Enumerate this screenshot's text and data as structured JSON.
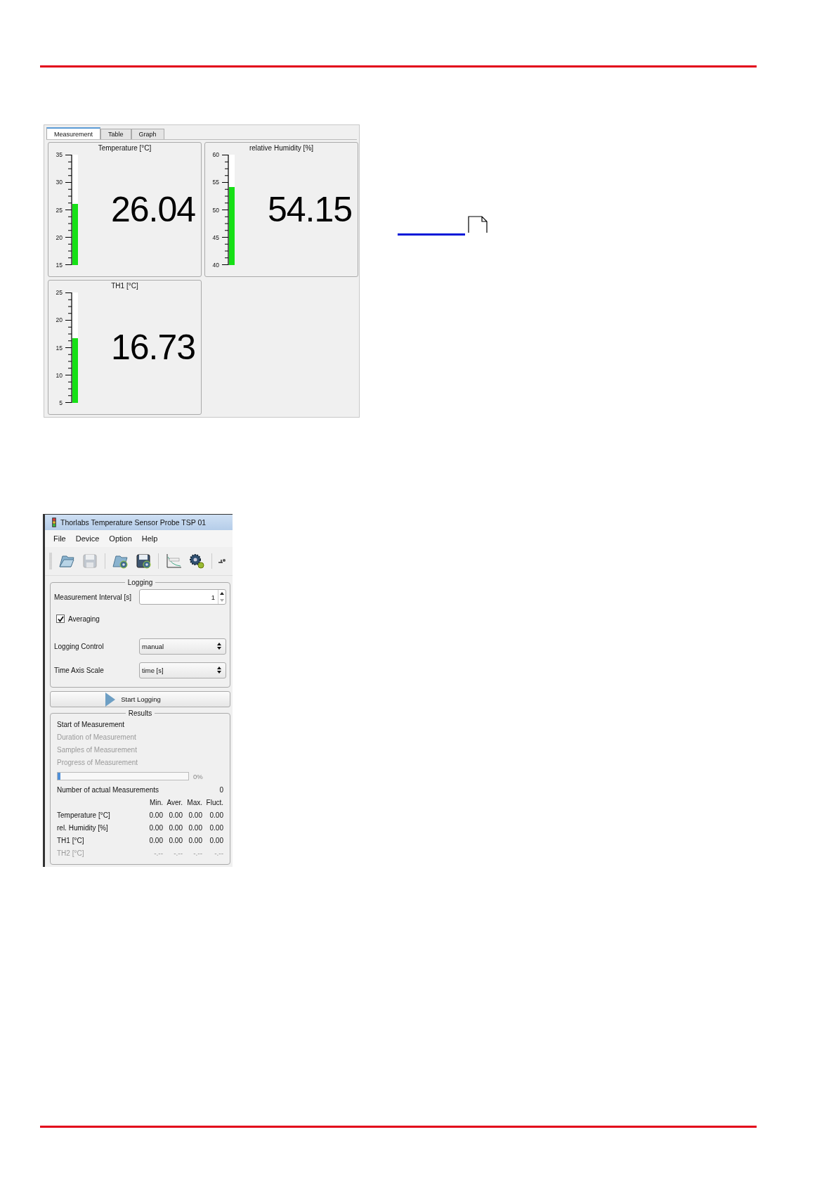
{
  "measurement_window": {
    "tabs": [
      {
        "label": "Measurement",
        "selected": true
      },
      {
        "label": "Table",
        "selected": false
      },
      {
        "label": "Graph",
        "selected": false
      }
    ],
    "meters": [
      {
        "title": "Temperature [°C]",
        "ticks": [
          "35",
          "30",
          "25",
          "20",
          "15"
        ],
        "level": 0.552,
        "value": "26.04"
      },
      {
        "title": "relative Humidity [%]",
        "ticks": [
          "60",
          "55",
          "50",
          "45",
          "40"
        ],
        "level": 0.7075,
        "value": "54.15"
      },
      {
        "title": "TH1 [°C]",
        "ticks": [
          "25",
          "20",
          "15",
          "10",
          "5"
        ],
        "level": 0.5865,
        "value": "16.73"
      }
    ]
  },
  "app_window": {
    "title": "Thorlabs Temperature Sensor Probe TSP 01",
    "menu": [
      "File",
      "Device",
      "Option",
      "Help"
    ],
    "toolbar": [
      {
        "kind": "open",
        "disabled": false
      },
      {
        "kind": "save",
        "disabled": true
      },
      {
        "kind": "separator"
      },
      {
        "kind": "open-config",
        "disabled": false
      },
      {
        "kind": "save-config",
        "disabled": false
      },
      {
        "kind": "separator"
      },
      {
        "kind": "clear",
        "disabled": false
      },
      {
        "kind": "settings",
        "disabled": false
      },
      {
        "kind": "separator"
      },
      {
        "kind": "connect",
        "disabled": false
      }
    ],
    "logging": {
      "title": "Logging",
      "interval_label": "Measurement Interval [s]",
      "interval_value": "1",
      "averaging": {
        "label": "Averaging",
        "checked": true
      },
      "selects": [
        {
          "label": "Logging Control",
          "value": "manual"
        },
        {
          "label": "Time Axis Scale",
          "value": "time [s]"
        }
      ]
    },
    "start_button": "Start Logging",
    "results": {
      "title": "Results",
      "lines": [
        {
          "text": "Start of Measurement",
          "disabled": false
        },
        {
          "text": "Duration of Measurement",
          "disabled": true
        },
        {
          "text": "Samples of Measurement",
          "disabled": true
        },
        {
          "text": "Progress of Measurement",
          "disabled": true
        }
      ],
      "progress": {
        "level": 0,
        "reading": "0%"
      },
      "count": {
        "label": "Number of actual Measurements",
        "value": "0"
      },
      "columns": [
        "Min.",
        "Aver.",
        "Max.",
        "Fluct."
      ],
      "rows": [
        {
          "label": "Temperature [°C]",
          "values": [
            "0.00",
            "0.00",
            "0.00",
            "0.00"
          ],
          "disabled": false
        },
        {
          "label": "rel. Humidity [%]",
          "values": [
            "0.00",
            "0.00",
            "0.00",
            "0.00"
          ],
          "disabled": false
        },
        {
          "label": "TH1 [°C]",
          "values": [
            "0.00",
            "0.00",
            "0.00",
            "0.00"
          ],
          "disabled": false
        },
        {
          "label": "TH2 [°C]",
          "values": [
            "-.--",
            "-.--",
            "-.--",
            "-.--"
          ],
          "disabled": true
        }
      ]
    }
  }
}
